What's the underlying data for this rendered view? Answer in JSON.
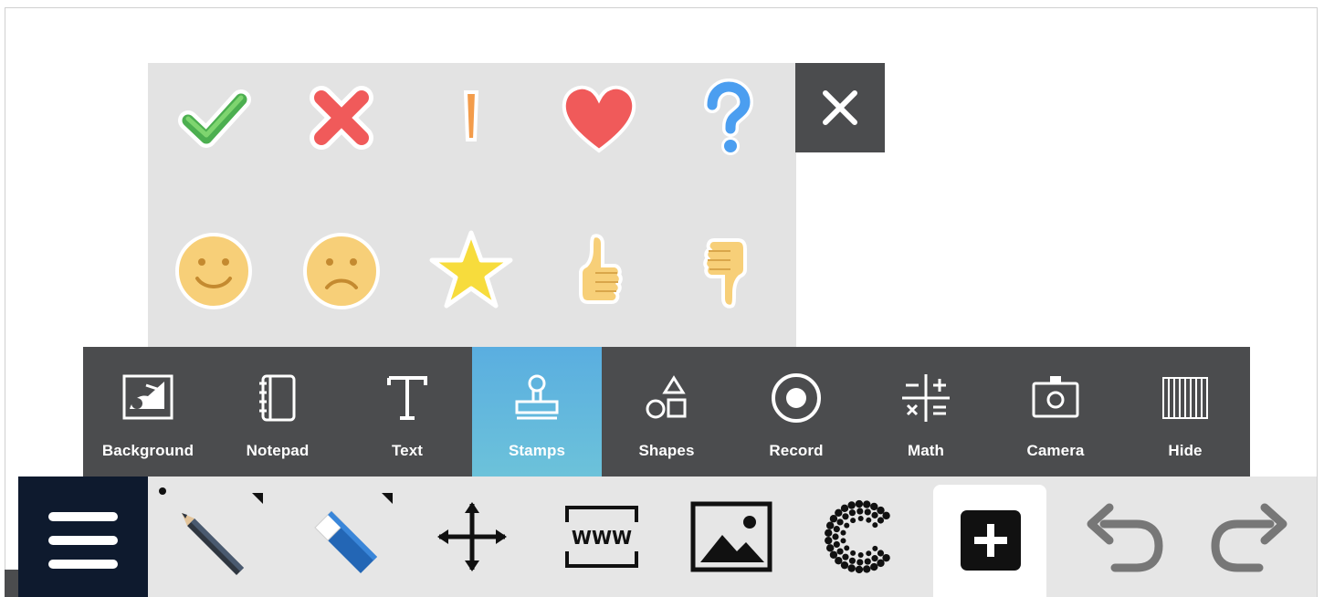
{
  "stamps": {
    "items": [
      {
        "name": "checkmark",
        "icon": "checkmark-icon",
        "color": "#4caf50"
      },
      {
        "name": "cross",
        "icon": "cross-icon",
        "color": "#f05a5a"
      },
      {
        "name": "exclamation",
        "icon": "exclamation-icon",
        "color": "#f39c4b"
      },
      {
        "name": "heart",
        "icon": "heart-icon",
        "color": "#f05a5a"
      },
      {
        "name": "question",
        "icon": "question-icon",
        "color": "#4b9ef0"
      },
      {
        "name": "smiley",
        "icon": "smiley-face-icon",
        "color": "#f7cf78"
      },
      {
        "name": "sad-face",
        "icon": "sad-face-icon",
        "color": "#f7cf78"
      },
      {
        "name": "star",
        "icon": "star-icon",
        "color": "#f7dc3c"
      },
      {
        "name": "thumbs-up",
        "icon": "thumbs-up-icon",
        "color": "#f7cf78"
      },
      {
        "name": "thumbs-down",
        "icon": "thumbs-down-icon",
        "color": "#f7cf78"
      }
    ],
    "close_icon": "close-icon"
  },
  "toolbar": {
    "items": [
      {
        "label": "Background",
        "icon": "background-icon"
      },
      {
        "label": "Notepad",
        "icon": "notepad-icon"
      },
      {
        "label": "Text",
        "icon": "text-icon"
      },
      {
        "label": "Stamps",
        "icon": "stamp-icon",
        "active": true
      },
      {
        "label": "Shapes",
        "icon": "shapes-icon"
      },
      {
        "label": "Record",
        "icon": "record-icon"
      },
      {
        "label": "Math",
        "icon": "math-icon"
      },
      {
        "label": "Camera",
        "icon": "camera-icon"
      },
      {
        "label": "Hide",
        "icon": "hide-icon"
      }
    ],
    "active_color": "#5aaee0",
    "background_color": "#4b4c4e"
  },
  "bottom_bar": {
    "menu_icon": "hamburger-menu-icon",
    "buttons": [
      {
        "name": "pencil",
        "icon": "pencil-icon"
      },
      {
        "name": "eraser",
        "icon": "eraser-icon"
      },
      {
        "name": "move",
        "icon": "move-arrows-icon"
      },
      {
        "name": "website",
        "icon": "www-icon",
        "text": "WWW"
      },
      {
        "name": "image",
        "icon": "image-icon"
      },
      {
        "name": "dotted-c",
        "icon": "dotted-c-icon"
      },
      {
        "name": "add",
        "icon": "add-icon"
      },
      {
        "name": "undo",
        "icon": "undo-icon"
      },
      {
        "name": "redo",
        "icon": "redo-icon"
      }
    ],
    "menu_color": "#0e1a2e"
  }
}
